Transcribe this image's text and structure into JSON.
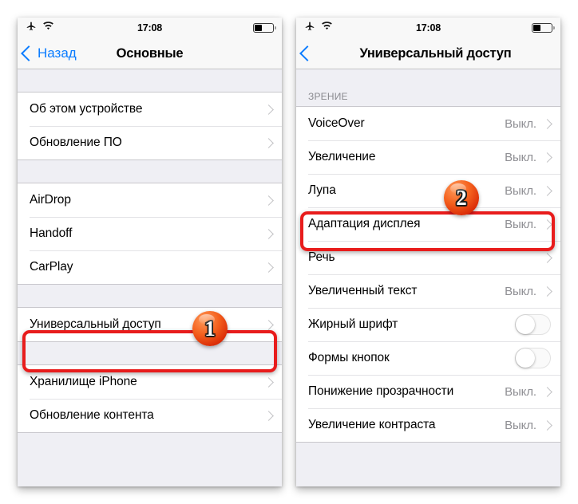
{
  "left_phone": {
    "status_bar": {
      "airplane_icon": "airplane-mode-icon",
      "wifi_icon": "wifi-icon",
      "time": "17:08",
      "battery_icon": "battery-icon",
      "battery_level_percent": 40
    },
    "nav": {
      "back_label": "Назад",
      "title": "Основные"
    },
    "groups": [
      {
        "rows": [
          {
            "label": "Об этом устройстве",
            "value": "",
            "accessory": "chevron"
          },
          {
            "label": "Обновление ПО",
            "value": "",
            "accessory": "chevron"
          }
        ]
      },
      {
        "rows": [
          {
            "label": "AirDrop",
            "value": "",
            "accessory": "chevron"
          },
          {
            "label": "Handoff",
            "value": "",
            "accessory": "chevron"
          },
          {
            "label": "CarPlay",
            "value": "",
            "accessory": "chevron"
          }
        ]
      },
      {
        "rows": [
          {
            "label": "Универсальный доступ",
            "value": "",
            "accessory": "chevron"
          }
        ]
      },
      {
        "rows": [
          {
            "label": "Хранилище iPhone",
            "value": "",
            "accessory": "chevron"
          },
          {
            "label": "Обновление контента",
            "value": "",
            "accessory": "chevron"
          }
        ]
      }
    ]
  },
  "right_phone": {
    "status_bar": {
      "airplane_icon": "airplane-mode-icon",
      "wifi_icon": "wifi-icon",
      "time": "17:08",
      "battery_icon": "battery-icon",
      "battery_level_percent": 40
    },
    "nav": {
      "back_label": "",
      "title": "Универсальный доступ"
    },
    "section_header": "ЗРЕНИЕ",
    "groups": [
      {
        "rows": [
          {
            "label": "VoiceOver",
            "value": "Выкл.",
            "accessory": "chevron"
          },
          {
            "label": "Увеличение",
            "value": "Выкл.",
            "accessory": "chevron"
          },
          {
            "label": "Лупа",
            "value": "Выкл.",
            "accessory": "chevron"
          },
          {
            "label": "Адаптация дисплея",
            "value": "Выкл.",
            "accessory": "chevron"
          },
          {
            "label": "Речь",
            "value": "",
            "accessory": "chevron"
          },
          {
            "label": "Увеличенный текст",
            "value": "Выкл.",
            "accessory": "chevron"
          },
          {
            "label": "Жирный шрифт",
            "value": "",
            "accessory": "toggle",
            "toggle_on": false
          },
          {
            "label": "Формы кнопок",
            "value": "",
            "accessory": "toggle",
            "toggle_on": false
          },
          {
            "label": "Понижение прозрачности",
            "value": "Выкл.",
            "accessory": "chevron"
          },
          {
            "label": "Увеличение контраста",
            "value": "Выкл.",
            "accessory": "chevron"
          }
        ]
      }
    ]
  },
  "annotations": {
    "highlight_color": "#e81c1c",
    "steps": [
      {
        "number": "1",
        "target": "Универсальный доступ"
      },
      {
        "number": "2",
        "target": "Адаптация дисплея"
      }
    ]
  }
}
